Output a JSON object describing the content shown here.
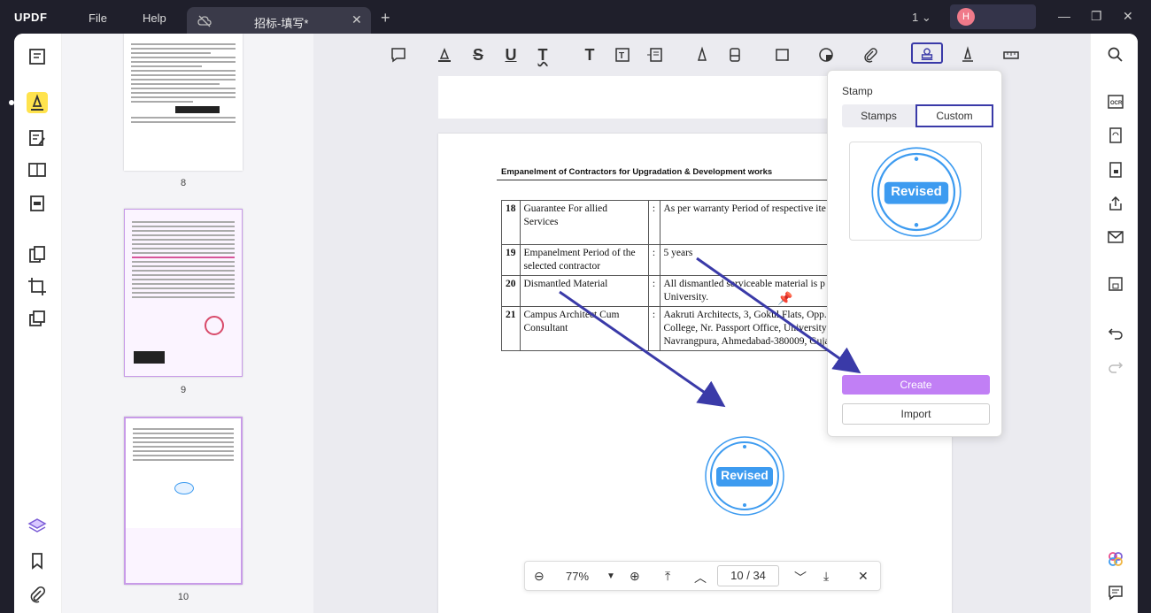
{
  "app": {
    "logo": "UPDF",
    "menu": [
      "File",
      "Help"
    ],
    "tab_title": "招标-填写*",
    "page_indicator": "1",
    "user_initial": "H"
  },
  "thumbnails": [
    {
      "label": "8"
    },
    {
      "label": "9"
    },
    {
      "label": "10"
    }
  ],
  "document": {
    "heading": "Empanelment of Contractors for Upgradation & Development works",
    "rows": [
      {
        "no": "18",
        "name": "Guarantee For allied Services",
        "value": "As per warranty Period of respective ite"
      },
      {
        "no": "19",
        "name": "Empanelment Period of the selected contractor",
        "value": "5 years"
      },
      {
        "no": "20",
        "name": "Dismantled Material",
        "value": "All dismantled serviceable material is p University."
      },
      {
        "no": "21",
        "name": "Campus Architect Cum Consultant",
        "value": "Aakruti Architects, 3, Gokul Flats, Opp. College, Nr. Passport Office, University Navrangpura, Ahmedabad-380009, Guja"
      }
    ]
  },
  "stamp_text": "Revised",
  "popover": {
    "title": "Stamp",
    "tab_stamps": "Stamps",
    "tab_custom": "Custom",
    "create_label": "Create",
    "import_label": "Import"
  },
  "bottom_nav": {
    "zoom": "77%",
    "current_page": "10",
    "separator": "/",
    "total_pages": "34"
  },
  "colors": {
    "accent": "#3a3aa8",
    "stamp_blue": "#3d9bf0",
    "create_purple": "#c17ff5",
    "highlight": "#ffe34d"
  }
}
